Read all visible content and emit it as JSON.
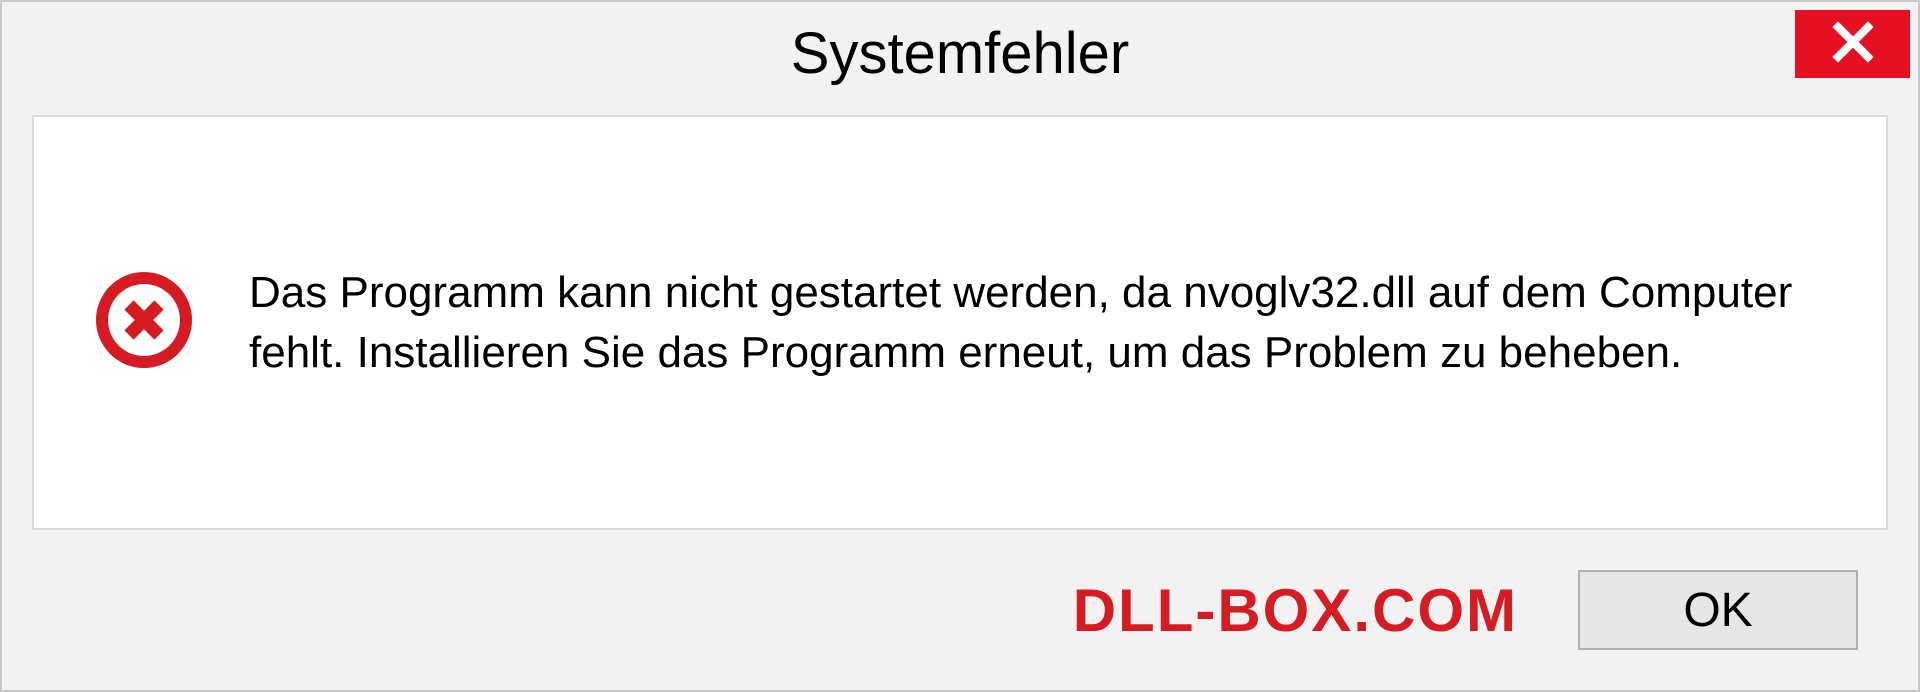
{
  "dialog": {
    "title": "Systemfehler",
    "message": "Das Programm kann nicht gestartet werden, da nvoglv32.dll auf dem Computer fehlt. Installieren Sie das Programm erneut, um das Problem zu beheben.",
    "ok_label": "OK"
  },
  "watermark": "DLL-BOX.COM"
}
